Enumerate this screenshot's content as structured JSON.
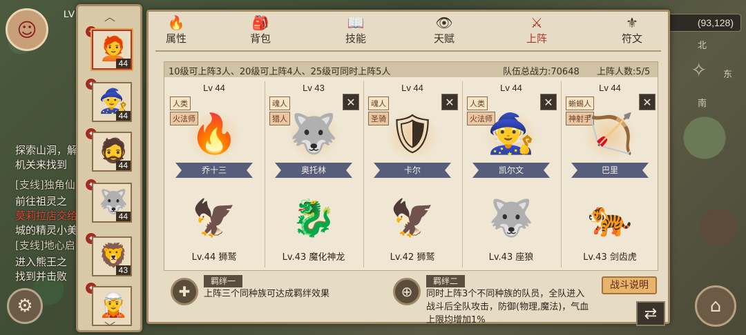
{
  "hud": {
    "level_prefix": "LV",
    "coordinates": "(93,128)",
    "compass": {
      "north": "北",
      "east": "东",
      "south": "南"
    },
    "quests": [
      {
        "text": "探索山洞，解",
        "cls": ""
      },
      {
        "text": "机关来找到",
        "cls": ""
      },
      {
        "text": "[支线]独角仙",
        "cls": "tag"
      },
      {
        "text": "前往祖灵之",
        "cls": ""
      },
      {
        "text": "莫莉拉店交给",
        "cls": "red"
      },
      {
        "text": "城的精灵小美",
        "cls": ""
      },
      {
        "text": "[支线]地心启",
        "cls": "tag"
      },
      {
        "text": "进入熊王之",
        "cls": ""
      },
      {
        "text": "找到并击败",
        "cls": ""
      }
    ]
  },
  "roster": [
    {
      "level": "44",
      "face": "🧑‍🦰",
      "selected": true
    },
    {
      "level": "44",
      "face": "🧙"
    },
    {
      "level": "44",
      "face": "🧔"
    },
    {
      "level": "44",
      "face": "🐺"
    },
    {
      "level": "43",
      "face": "🦁"
    },
    {
      "level": "",
      "face": "🧝"
    }
  ],
  "tabs": [
    {
      "label": "属性",
      "icon": "🔥"
    },
    {
      "label": "背包",
      "icon": "🎒"
    },
    {
      "label": "技能",
      "icon": "📖"
    },
    {
      "label": "天赋",
      "icon": "👁"
    },
    {
      "label": "上阵",
      "icon": "⚔",
      "active": true
    },
    {
      "label": "符文",
      "icon": "⚜"
    }
  ],
  "team": {
    "rule_text": "10级可上阵3人、20级可上阵4人、25级可同时上阵5人",
    "power_text": "队伍总战力:70648",
    "count_text": "上阵人数:5/5",
    "heroes": [
      {
        "level": "Lv 44",
        "race": "人类",
        "class": "火法师",
        "name": "乔十三",
        "figure": "🔥",
        "removable": false,
        "pet": {
          "label": "Lv.44 狮鹫",
          "figure": "🦅"
        }
      },
      {
        "level": "Lv 43",
        "race": "魂人",
        "class": "猎人",
        "name": "奥托林",
        "figure": "🐺",
        "removable": true,
        "pet": {
          "label": "Lv.43 魔化神龙",
          "figure": "🐉"
        }
      },
      {
        "level": "Lv 44",
        "race": "魂人",
        "class": "圣骑",
        "name": "卡尔",
        "figure": "🛡",
        "removable": true,
        "pet": {
          "label": "Lv.42 狮鹫",
          "figure": "🦅"
        }
      },
      {
        "level": "Lv 44",
        "race": "人类",
        "class": "火法师",
        "name": "凯尔文",
        "figure": "🧙",
        "removable": true,
        "pet": {
          "label": "Lv.43 座狼",
          "figure": "🐺"
        }
      },
      {
        "level": "Lv 44",
        "race": "蜥蜴人",
        "class": "神射手",
        "name": "巴里",
        "figure": "🏹",
        "removable": true,
        "pet": {
          "label": "Lv.43 剑齿虎",
          "figure": "🐅"
        }
      }
    ]
  },
  "bonds": {
    "first": {
      "title": "羁绊一",
      "desc": "上阵三个同种族可达成羁绊效果"
    },
    "second": {
      "title": "羁绊二",
      "desc_lines": [
        "同时上阵3个不同种族的队员，全队进入",
        "战斗后全队攻击，防御(物理,魔法)，气血",
        "上限均增加1%"
      ]
    }
  },
  "buttons": {
    "battle_help": "战斗说明",
    "swap": "⇄",
    "remove": "✕"
  },
  "strip": {
    "up": "︿",
    "down": "﹀"
  }
}
